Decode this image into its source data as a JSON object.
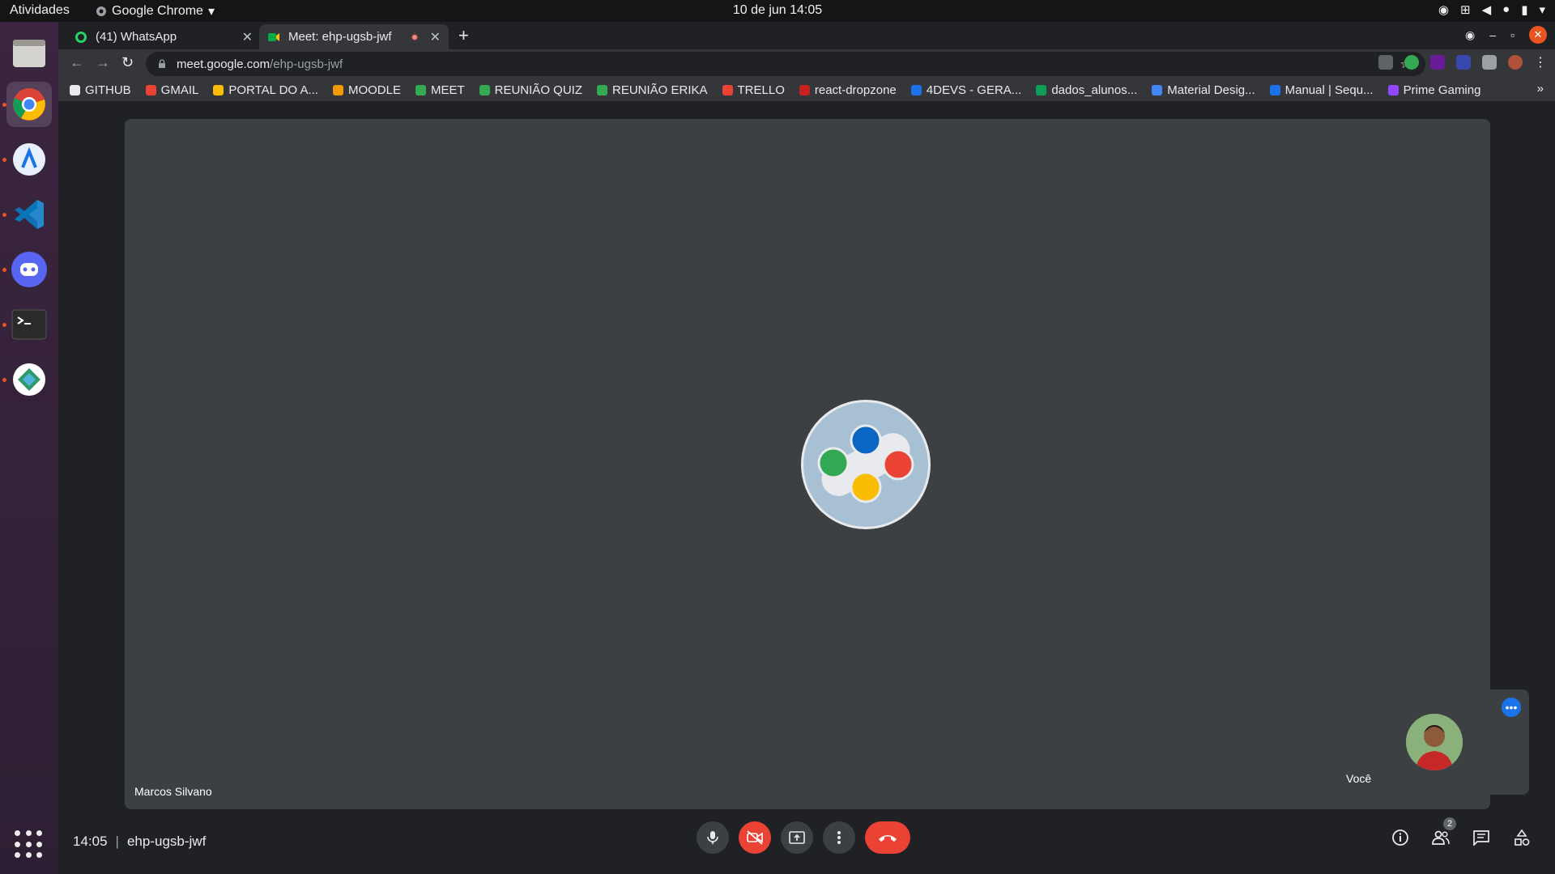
{
  "os": {
    "activities": "Atividades",
    "app_name": "Google Chrome",
    "clock": "10 de jun  14:05"
  },
  "browser": {
    "tabs": [
      {
        "title": "(41) WhatsApp"
      },
      {
        "title": "Meet: ehp-ugsb-jwf"
      }
    ],
    "url_host": "meet.google.com",
    "url_path": "/ehp-ugsb-jwf",
    "bookmarks": [
      {
        "label": "GITHUB",
        "color": "#e8eaed"
      },
      {
        "label": "GMAIL",
        "color": "#ea4335"
      },
      {
        "label": "PORTAL DO A...",
        "color": "#fbbc04"
      },
      {
        "label": "MOODLE",
        "color": "#f29900"
      },
      {
        "label": "MEET",
        "color": "#34a853"
      },
      {
        "label": "REUNIÃO QUIZ",
        "color": "#34a853"
      },
      {
        "label": "REUNIÃO ERIKA",
        "color": "#34a853"
      },
      {
        "label": "TRELLO",
        "color": "#ea4335"
      },
      {
        "label": "react-dropzone",
        "color": "#c5221f"
      },
      {
        "label": "4DEVS - GERA...",
        "color": "#1a73e8"
      },
      {
        "label": "dados_alunos...",
        "color": "#0f9d58"
      },
      {
        "label": "Material Desig...",
        "color": "#4285f4"
      },
      {
        "label": "Manual | Sequ...",
        "color": "#1a73e8"
      },
      {
        "label": "Prime Gaming",
        "color": "#9146ff"
      }
    ]
  },
  "meet": {
    "presenter_name": "Marcos Silvano",
    "self_name": "Você",
    "time": "14:05",
    "separator": "|",
    "meeting_code": "ehp-ugsb-jwf",
    "participants_count": "2"
  }
}
